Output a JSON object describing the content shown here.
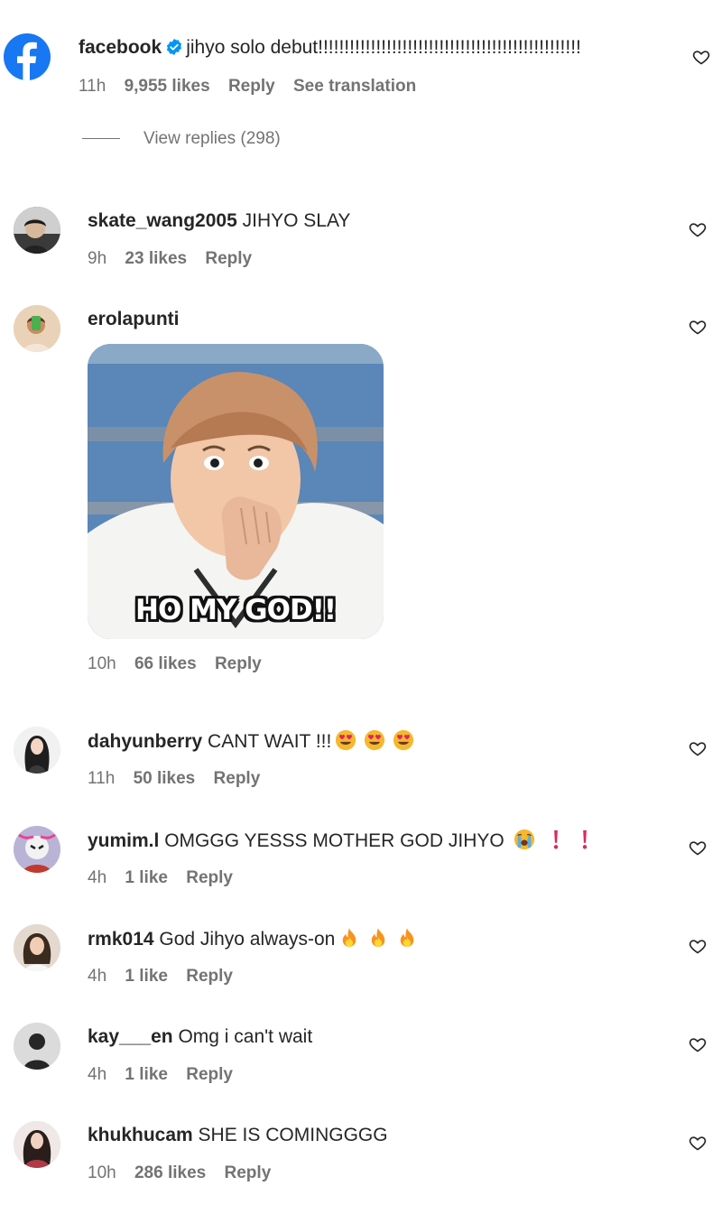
{
  "colors": {
    "text": "#262626",
    "meta": "#737373",
    "facebook_blue": "#1877f2",
    "verified_blue": "#0095f6",
    "alert_red": "#e0245e",
    "fire_orange": "#f7931e"
  },
  "comments": [
    {
      "username": "facebook",
      "verified": true,
      "text": "jihyo solo debut!!!!!!!!!!!!!!!!!!!!!!!!!!!!!!!!!!!!!!!!!!!!!!!!!!",
      "time": "11h",
      "likes": "9,955 likes",
      "reply": "Reply",
      "translate": "See translation",
      "view_replies": "View replies (298)"
    },
    {
      "username": "skate_wang2005",
      "text": "JIHYO SLAY",
      "time": "9h",
      "likes": "23 likes",
      "reply": "Reply"
    },
    {
      "username": "erolapunti",
      "text": "",
      "gif_caption": "HO MY GOD!!",
      "time": "10h",
      "likes": "66 likes",
      "reply": "Reply"
    },
    {
      "username": "dahyunberry",
      "text": "CANT WAIT !!!",
      "emojis": [
        "heart-eyes-icon",
        "heart-eyes-icon",
        "heart-eyes-icon"
      ],
      "time": "11h",
      "likes": "50 likes",
      "reply": "Reply"
    },
    {
      "username": "yumim.l",
      "text": "OMGGG YESSS MOTHER GOD JIHYO",
      "emojis": [
        "loudly-crying-icon",
        "exclamation-icon",
        "exclamation-icon"
      ],
      "time": "4h",
      "likes": "1 like",
      "reply": "Reply"
    },
    {
      "username": "rmk014",
      "text": "God Jihyo always-on",
      "emojis": [
        "fire-icon",
        "fire-icon",
        "fire-icon"
      ],
      "time": "4h",
      "likes": "1 like",
      "reply": "Reply"
    },
    {
      "username": "kay___en",
      "text": "Omg i can't wait",
      "time": "4h",
      "likes": "1 like",
      "reply": "Reply"
    },
    {
      "username": "khukhucam",
      "text": "SHE IS COMINGGGG",
      "time": "10h",
      "likes": "286 likes",
      "reply": "Reply"
    }
  ]
}
